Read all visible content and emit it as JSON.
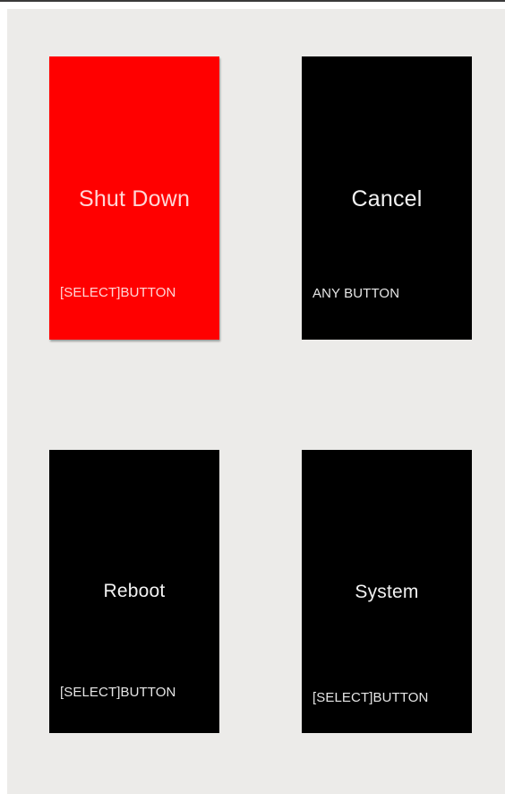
{
  "colors": {
    "background": "#ecebe9",
    "tile": "#000000",
    "tile_selected": "#ff0000",
    "text": "#f2f2f2"
  },
  "tiles": [
    {
      "title": "Shut Down",
      "hint": "[SELECT]BUTTON",
      "selected": true
    },
    {
      "title": "Cancel",
      "hint": "ANY BUTTON",
      "selected": false
    },
    {
      "title": "Reboot",
      "hint": "[SELECT]BUTTON",
      "selected": false
    },
    {
      "title": "System",
      "hint": "[SELECT]BUTTON",
      "selected": false
    }
  ]
}
